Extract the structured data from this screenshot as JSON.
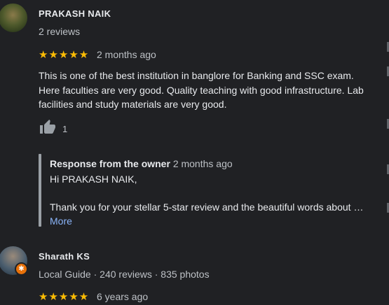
{
  "reviews": [
    {
      "name": "PRAKASH NAIK",
      "meta": "2 reviews",
      "stars": "★★★★★",
      "rating": 5,
      "date": "2 months ago",
      "text": "This is one of the best institution in banglore for Banking and SSC exam. Here faculties are very good. Quality teaching with good infrastructure. Lab facilities and study materials are very good.",
      "likes": "1",
      "response": {
        "title": "Response from the owner",
        "date": "2 months ago",
        "greeting": "Hi PRAKASH NAIK,",
        "body": "Thank you for your stellar 5-star review and the beautiful words about …",
        "more": "More"
      }
    },
    {
      "name": "Sharath KS",
      "meta": "Local Guide · 240 reviews · 835 photos",
      "stars": "★★★★★",
      "rating": 5,
      "date": "6 years ago"
    }
  ],
  "colors": {
    "star": "#fbbc04",
    "link": "#8ab4f8",
    "background": "#202124",
    "local_guide_badge": "#e8710a"
  }
}
